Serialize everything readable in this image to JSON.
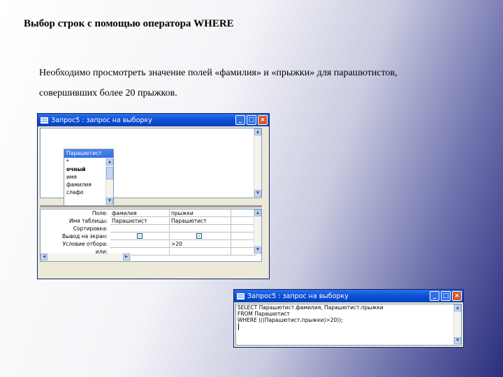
{
  "slide": {
    "title": "Выбор строк с помощью оператора WHERE",
    "line1": "Необходимо просмотреть значение полей «фамилия» и «прыжки» для парашютистов,",
    "line2": "совершивших более 20 прыжков."
  },
  "design_window": {
    "title": "Запрос5 : запрос на выборку",
    "table_box": {
      "name": "Парашютист",
      "fields": [
        "*",
        "очный",
        "имя",
        "фамилия",
        "слафо"
      ]
    },
    "row_labels": [
      "Поле:",
      "Имя таблицы:",
      "Сортировка:",
      "Вывод на экран:",
      "Условие отбора:",
      "или:"
    ],
    "columns": [
      {
        "field": "фамилия",
        "table": "Парашютист",
        "sort": "",
        "show": true,
        "criteria": "",
        "or": ""
      },
      {
        "field": "прыжки",
        "table": "Парашютист",
        "sort": "",
        "show": true,
        "criteria": ">20",
        "or": ""
      }
    ],
    "check_glyph": "✓"
  },
  "sql_window": {
    "title": "Запрос5 : запрос на выборку",
    "sql_lines": [
      "SELECT Парашютист.фамилия, Парашютист.прыжки",
      "FROM Парашютист",
      "WHERE (((Парашютист.прыжки)>20));"
    ]
  },
  "window_buttons": {
    "minimize": "_",
    "maximize": "□",
    "close": "×"
  }
}
